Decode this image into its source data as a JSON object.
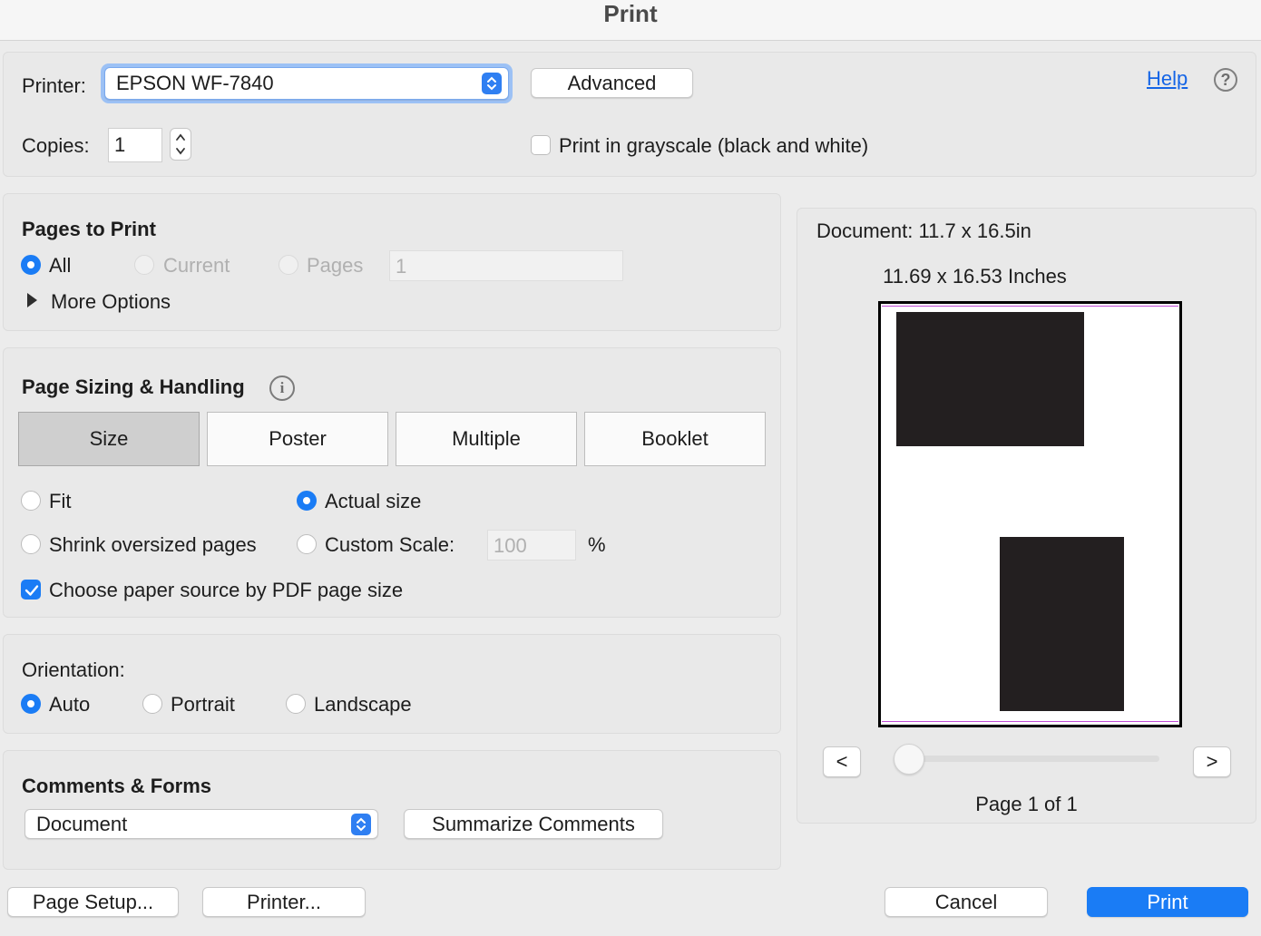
{
  "window": {
    "title": "Print"
  },
  "printer": {
    "label": "Printer:",
    "selected": "EPSON WF-7840",
    "advanced_label": "Advanced",
    "help_label": "Help",
    "help_icon": "?"
  },
  "copies": {
    "label": "Copies:",
    "value": "1",
    "grayscale_label": "Print in grayscale (black and white)",
    "grayscale_checked": false
  },
  "pages_to_print": {
    "heading": "Pages to Print",
    "options": [
      "All",
      "Current",
      "Pages"
    ],
    "selected": "All",
    "pages_value": "1",
    "more_options_label": "More Options"
  },
  "page_sizing": {
    "heading": "Page Sizing & Handling",
    "info_icon": "i",
    "tabs": [
      "Size",
      "Poster",
      "Multiple",
      "Booklet"
    ],
    "selected_tab": "Size",
    "fit_label": "Fit",
    "actual_size_label": "Actual size",
    "shrink_label": "Shrink oversized pages",
    "custom_scale_label": "Custom Scale:",
    "custom_scale_value": "100",
    "percent": "%",
    "selected_option": "Actual size",
    "paper_source_label": "Choose paper source by PDF page size",
    "paper_source_checked": true
  },
  "orientation": {
    "label": "Orientation:",
    "options": [
      "Auto",
      "Portrait",
      "Landscape"
    ],
    "selected": "Auto"
  },
  "comments_forms": {
    "heading": "Comments & Forms",
    "selected": "Document",
    "summarize_label": "Summarize Comments"
  },
  "preview": {
    "document_size": "Document: 11.7 x 16.5in",
    "paper_size": "11.69 x 16.53 Inches",
    "prev_label": "<",
    "next_label": ">",
    "page_indicator": "Page 1 of 1"
  },
  "footer": {
    "page_setup_label": "Page Setup...",
    "printer_label": "Printer...",
    "cancel_label": "Cancel",
    "print_label": "Print"
  },
  "colors": {
    "accent": "#1a7cf5",
    "link": "#1565e6"
  }
}
